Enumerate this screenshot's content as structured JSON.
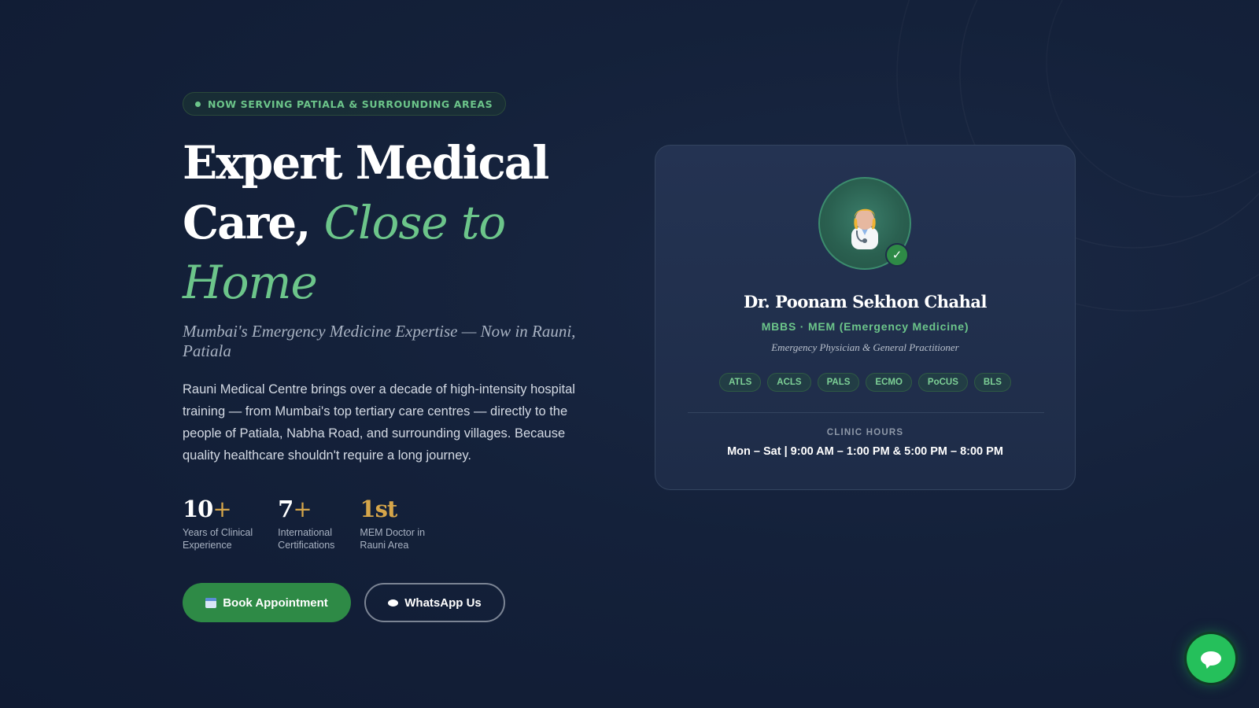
{
  "hero": {
    "badge": "NOW SERVING PATIALA & SURROUNDING AREAS",
    "headline_line1": "Expert Medical",
    "headline_line2_plain": "Care,",
    "headline_line2_accent": "Close to Home",
    "subtitle": "Mumbai's Emergency Medicine Expertise — Now in Rauni, Patiala",
    "description": "Rauni Medical Centre brings over a decade of high-intensity hospital training — from Mumbai's top tertiary care centres — directly to the people of Patiala, Nabha Road, and surrounding villages. Because quality healthcare shouldn't require a long journey.",
    "stats": [
      {
        "number": "10",
        "suffix": "+",
        "label": "Years of Clinical\nExperience"
      },
      {
        "number": "7",
        "suffix": "+",
        "label": "International\nCertifications"
      },
      {
        "number": "1st",
        "suffix": "",
        "label": "MEM Doctor in\nRauni Area"
      }
    ],
    "book_label": "Book Appointment",
    "whatsapp_label": "WhatsApp Us"
  },
  "doctor": {
    "name": "Dr. Poonam Sekhon Chahal",
    "qualifications": "MBBS · MEM (Emergency Medicine)",
    "role": "Emergency Physician & General Practitioner",
    "verified_mark": "✓",
    "certifications": [
      "ATLS",
      "ACLS",
      "PALS",
      "ECMO",
      "PoCUS",
      "BLS"
    ],
    "hours_label": "CLINIC HOURS",
    "hours_value": "Mon – Sat  |  9:00 AM – 1:00 PM & 5:00 PM – 8:00 PM"
  },
  "icons": {
    "book": "calendar-icon",
    "whatsapp": "chat-bubble-icon",
    "floating": "chat-bubble-icon",
    "verified": "checkmark-icon",
    "avatar": "doctor-icon"
  },
  "colors": {
    "accent_green": "#6cc58a",
    "button_green": "#2e8a46",
    "gold": "#d6a64a",
    "background": "#14213a"
  }
}
